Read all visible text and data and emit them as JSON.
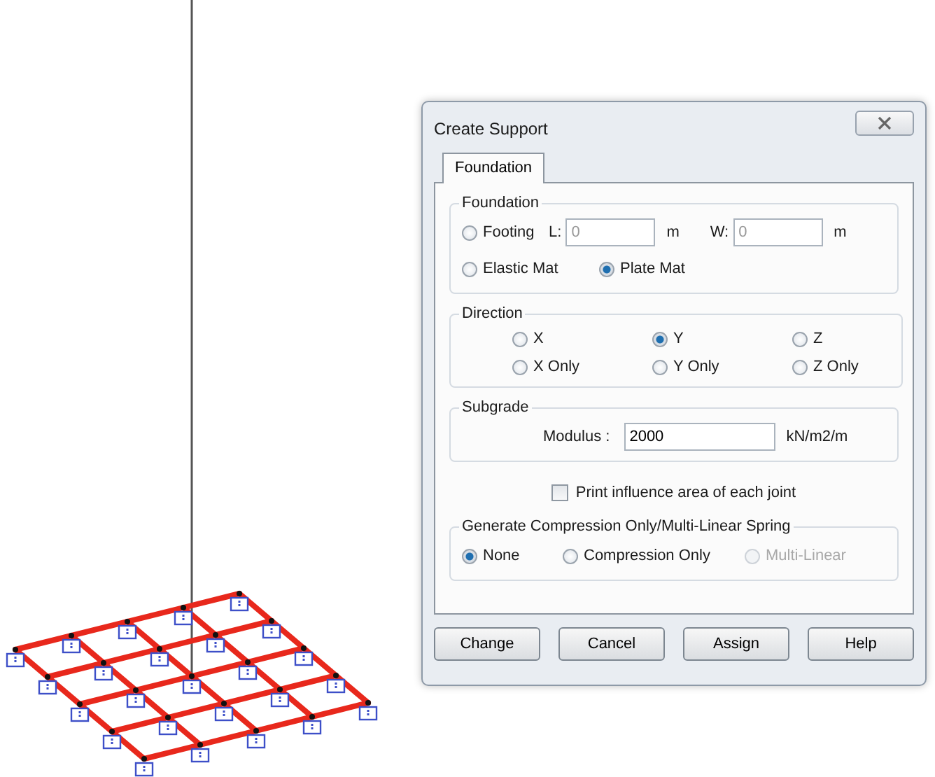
{
  "window": {
    "title": "Create Support"
  },
  "tabs": [
    {
      "label": "Foundation",
      "selected": true
    }
  ],
  "foundation": {
    "title": "Foundation",
    "options": [
      {
        "label": "Footing",
        "selected": false
      },
      {
        "label": "Elastic Mat",
        "selected": false
      },
      {
        "label": "Plate Mat",
        "selected": true
      }
    ],
    "length": {
      "label": "L:",
      "value": "0",
      "unit": "m",
      "disabled": true
    },
    "width": {
      "label": "W:",
      "value": "0",
      "unit": "m",
      "disabled": true
    }
  },
  "direction": {
    "title": "Direction",
    "options": [
      {
        "label": "X",
        "selected": false
      },
      {
        "label": "Y",
        "selected": true
      },
      {
        "label": "Z",
        "selected": false
      },
      {
        "label": "X Only",
        "selected": false
      },
      {
        "label": "Y Only",
        "selected": false
      },
      {
        "label": "Z Only",
        "selected": false
      }
    ]
  },
  "subgrade": {
    "title": "Subgrade",
    "label": "Modulus :",
    "value": "2000",
    "unit": "kN/m2/m"
  },
  "print_influence": {
    "label": "Print influence area of each joint",
    "checked": false
  },
  "spring": {
    "title": "Generate Compression Only/Multi-Linear Spring",
    "options": [
      {
        "label": "None",
        "selected": true,
        "disabled": false
      },
      {
        "label": "Compression Only",
        "selected": false,
        "disabled": false
      },
      {
        "label": "Multi-Linear",
        "selected": false,
        "disabled": true
      }
    ]
  },
  "buttons": [
    "Change",
    "Cancel",
    "Assign",
    "Help"
  ]
}
